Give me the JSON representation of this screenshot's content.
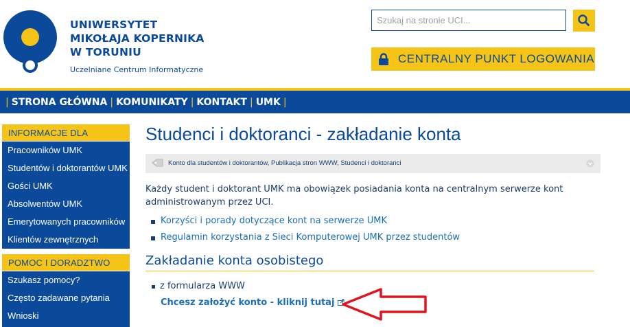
{
  "header": {
    "university_name": "UNIWERSYTET\nMIKOŁAJA KOPERNIKA\nW TORUNIU",
    "unit_name": "Uczelniane Centrum Informatyczne",
    "search_placeholder": "Szukaj na stronie UCI...",
    "login_label": "CENTRALNY PUNKT LOGOWANIA",
    "icons": [
      "logo",
      "search-icon",
      "lock-icon"
    ]
  },
  "nav": {
    "items": [
      "STRONA GŁÓWNA",
      "KOMUNIKATY",
      "KONTAKT",
      "UMK"
    ]
  },
  "sidebar": {
    "section1_title": "INFORMACJE DLA",
    "section1_items": [
      "Pracowników UMK",
      "Studentów i doktorantów UMK",
      "Gości UMK",
      "Absolwentów UMK",
      "Emerytowanych pracowników",
      "Klientów zewnętrznych"
    ],
    "section2_title": "POMOC I DORADZTWO",
    "section2_items": [
      "Szukasz pomocy?",
      "Często zadawane pytania",
      "Wnioski"
    ]
  },
  "main": {
    "title": "Studenci i doktoranci - zakładanie konta",
    "tags": "Konto dla studentów i doktorantów, Publikacja stron WWW, Studenci i doktoranci",
    "intro": "Każdy student i doktorant UMK ma obowiązek posiadania konta na centralnym serwerze kont administrowanym przez UCI.",
    "links": [
      "Korzyści i porady dotyczące kont na serwerze UMK",
      "Regulamin korzystania z Sieci Komputerowej UMK przez studentów"
    ],
    "subheading": "Zakładanie konta osobistego",
    "form_item": "z formularza WWW",
    "cta_link": "Chcesz założyć konto - kliknij tutaj"
  },
  "colors": {
    "brand_blue": "#0b4a9b",
    "accent_yellow": "#f6c416",
    "link_blue": "#1a6fb5",
    "arrow_red": "#e0141e"
  }
}
